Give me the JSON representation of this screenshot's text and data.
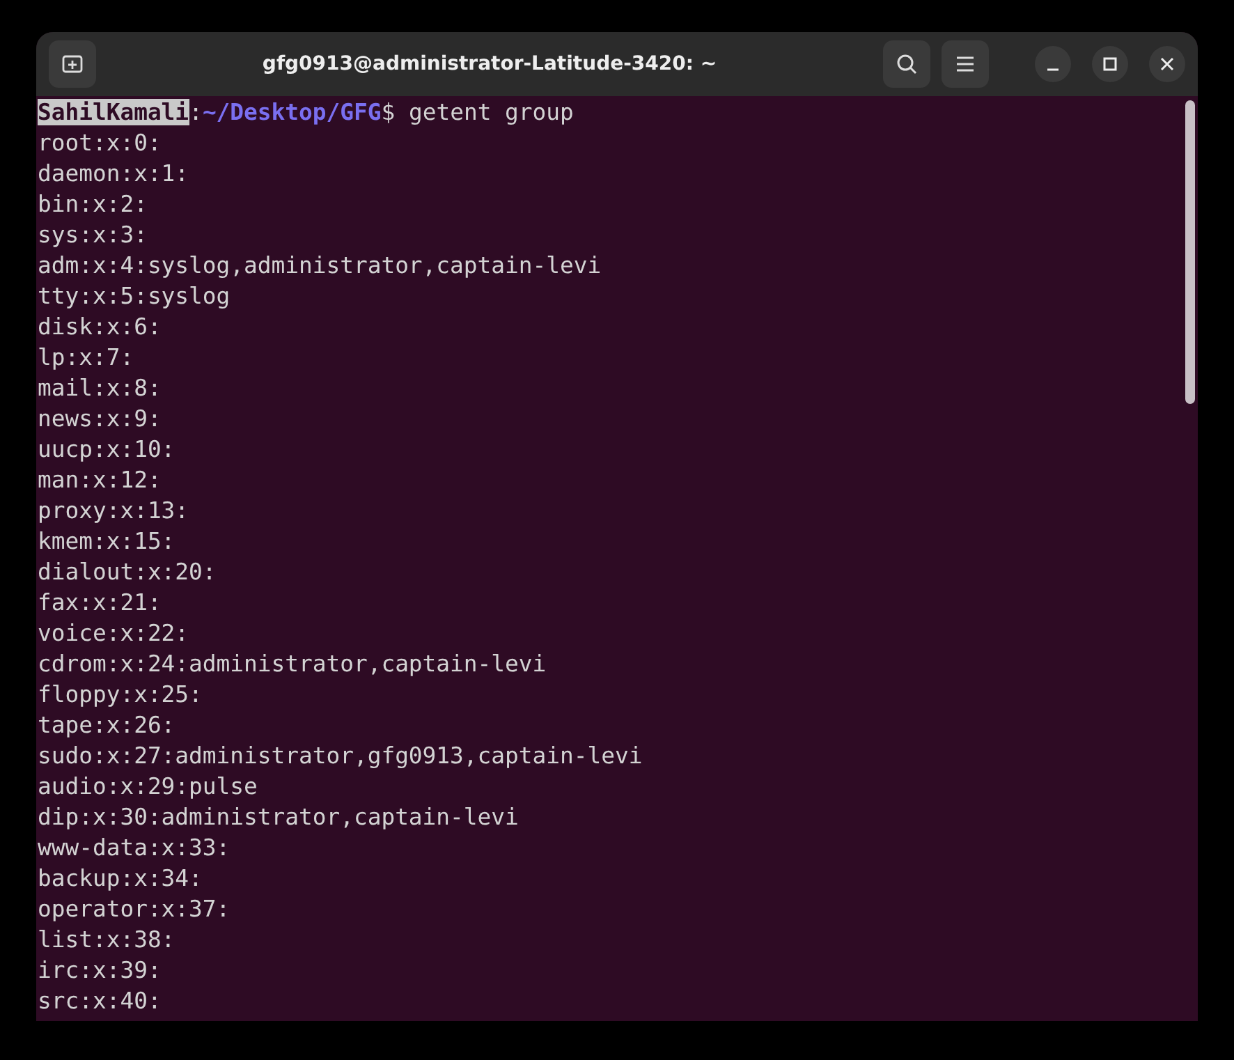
{
  "window": {
    "title": "gfg0913@administrator-Latitude-3420: ~"
  },
  "prompt": {
    "user": "SahilKamali",
    "user_selected": true,
    "separator": ":",
    "path": "~/Desktop/GFG",
    "symbol": "$",
    "command": " getent group"
  },
  "output": [
    "root:x:0:",
    "daemon:x:1:",
    "bin:x:2:",
    "sys:x:3:",
    "adm:x:4:syslog,administrator,captain-levi",
    "tty:x:5:syslog",
    "disk:x:6:",
    "lp:x:7:",
    "mail:x:8:",
    "news:x:9:",
    "uucp:x:10:",
    "man:x:12:",
    "proxy:x:13:",
    "kmem:x:15:",
    "dialout:x:20:",
    "fax:x:21:",
    "voice:x:22:",
    "cdrom:x:24:administrator,captain-levi",
    "floppy:x:25:",
    "tape:x:26:",
    "sudo:x:27:administrator,gfg0913,captain-levi",
    "audio:x:29:pulse",
    "dip:x:30:administrator,captain-levi",
    "www-data:x:33:",
    "backup:x:34:",
    "operator:x:37:",
    "list:x:38:",
    "irc:x:39:",
    "src:x:40:"
  ]
}
